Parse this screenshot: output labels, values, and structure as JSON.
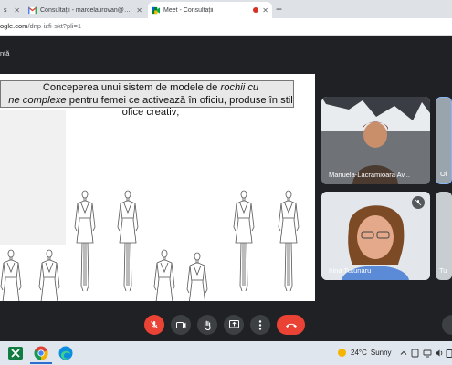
{
  "browser": {
    "tabs": [
      {
        "title": "ș",
        "active": false
      },
      {
        "title": "Consultații - marcela.irovan@gm",
        "active": false
      },
      {
        "title": "Meet - Consultații",
        "active": true,
        "recording": true
      }
    ],
    "address": {
      "visible": "ogle.com/dnp-izfi-skt?pli=1",
      "host_part": "ogle.com",
      "path_part": "/dnp-izfi-skt?pli=1"
    }
  },
  "meet": {
    "presenting_label": "ntă",
    "slide": {
      "line1_normal": "Conceperea unui sistem de modele de ",
      "line1_italic": "rochii cu",
      "line2_italic": "ne complexe",
      "line2_normal": " pentru femei ce activează în oficiu, produse în stil",
      "line3": "ofice creativ;"
    },
    "participants": [
      {
        "name": "Manuela-Lacramioara Av...",
        "muted": false
      },
      {
        "name": "Ol",
        "muted": false
      },
      {
        "name": "Irina Tutunaru",
        "muted": true
      },
      {
        "name": "Tu",
        "muted": false
      }
    ],
    "controls": [
      "mic-off",
      "camera",
      "raise-hand",
      "present",
      "more",
      "leave-call"
    ]
  },
  "taskbar": {
    "temperature": "24°C",
    "weather": "Sunny"
  },
  "colors": {
    "meet_bg": "#202124",
    "danger": "#ea4335",
    "control_bg": "#3c4043",
    "tab_strip": "#dee1e6"
  }
}
